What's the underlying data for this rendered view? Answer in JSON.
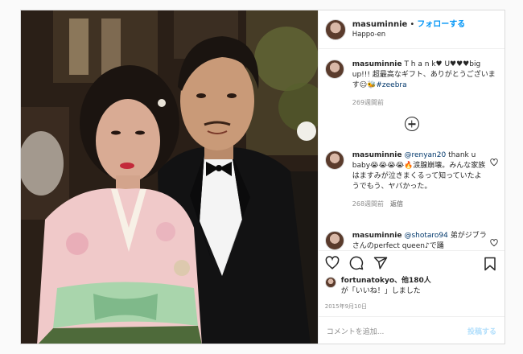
{
  "header": {
    "username": "masuminnie",
    "separator": "•",
    "follow_label": "フォローする",
    "location": "Happo-en"
  },
  "caption": {
    "username": "masuminnie",
    "text": "T h a n k♥ U♥♥♥big up!!! 超最高なギフト、ありがとうございます☺",
    "emoji": "🐝",
    "hashtag": "#zeebra",
    "time": "269週間前"
  },
  "comments": [
    {
      "username": "masuminnie",
      "mention": "@renyan20",
      "text": "thank u baby😭😭😭😭🔥涙腺崩壊。みんな家族はますみが泣きまくるって知っていたようでもう、ヤバかった。",
      "time": "268週間前",
      "reply": "返信"
    },
    {
      "username": "masuminnie",
      "mention": "@shotaro94",
      "text": "弟がジブラさんのperfect queen♪で踊"
    }
  ],
  "likes": {
    "user": "fortunatokyo",
    "others": "、他180人",
    "suffix": "が「いいね！」しました"
  },
  "date": "2015年9月10日",
  "add_comment": {
    "placeholder": "コメントを追加...",
    "post_label": "投稿する"
  },
  "icons": {
    "heart": "heart-icon",
    "comment": "comment-icon",
    "share": "share-icon",
    "save": "bookmark-icon",
    "more": "plus-circle-icon"
  }
}
